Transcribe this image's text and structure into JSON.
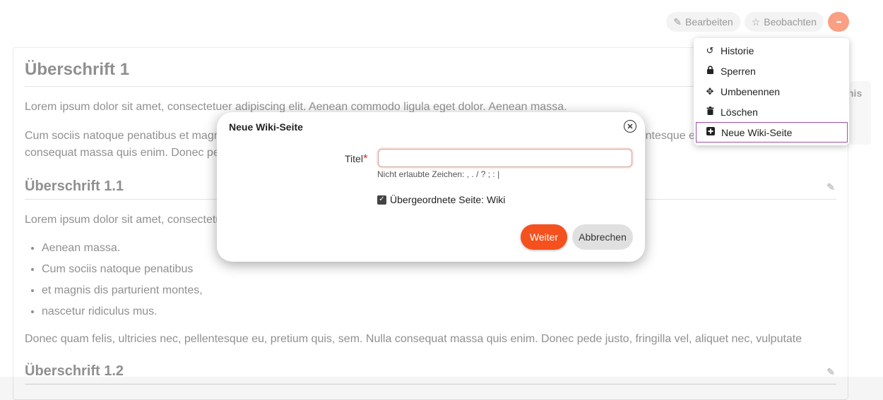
{
  "toolbar": {
    "edit_label": "Bearbeiten",
    "watch_label": "Beobachten",
    "more_label": "•••"
  },
  "article": {
    "h1": "Überschrift 1",
    "p1": "Lorem ipsum dolor sit amet, consectetuer adipiscing elit. Aenean commodo ligula eget dolor. Aenean massa.",
    "p2": "Cum sociis natoque penatibus et magnis dis parturient montes, nascetur ridiculus mus. Donec quam felis, ultricies nec, pellentesque eu, pretium quis, sem. Nulla consequat massa quis enim. Donec pede justo, fringilla vel, aliquet nec, vulputate",
    "h2a": "Überschrift 1.1",
    "p3": "Lorem ipsum dolor sit amet, consectetuer adipiscing elit. Aenean commodo ligula eget dolor.",
    "list": [
      "Aenean massa.",
      "Cum sociis natoque penatibus",
      "et magnis dis parturient montes,",
      "nascetur ridiculus mus."
    ],
    "p4": "Donec quam felis, ultricies nec, pellentesque eu, pretium quis, sem. Nulla consequat massa quis enim. Donec pede justo, fringilla vel, aliquet nec, vulputate",
    "h2b": "Überschrift 1.2",
    "side_hint": "nis"
  },
  "menu": {
    "items": [
      {
        "label": "Historie",
        "icon": "history-icon"
      },
      {
        "label": "Sperren",
        "icon": "lock-icon"
      },
      {
        "label": "Umbenennen",
        "icon": "move-icon"
      },
      {
        "label": "Löschen",
        "icon": "trash-icon"
      },
      {
        "label": "Neue Wiki-Seite",
        "icon": "plus-square-icon"
      }
    ]
  },
  "modal": {
    "title": "Neue Wiki-Seite",
    "field_label": "Titel",
    "required_mark": "*",
    "title_value": "",
    "hint": "Nicht erlaubte Zeichen: , . / ? ; : |",
    "checkbox_label": "Übergeordnete Seite: Wiki",
    "submit_label": "Weiter",
    "cancel_label": "Abbrechen"
  },
  "colors": {
    "accent": "#f4511e",
    "focus_outline": "#a24da8"
  }
}
